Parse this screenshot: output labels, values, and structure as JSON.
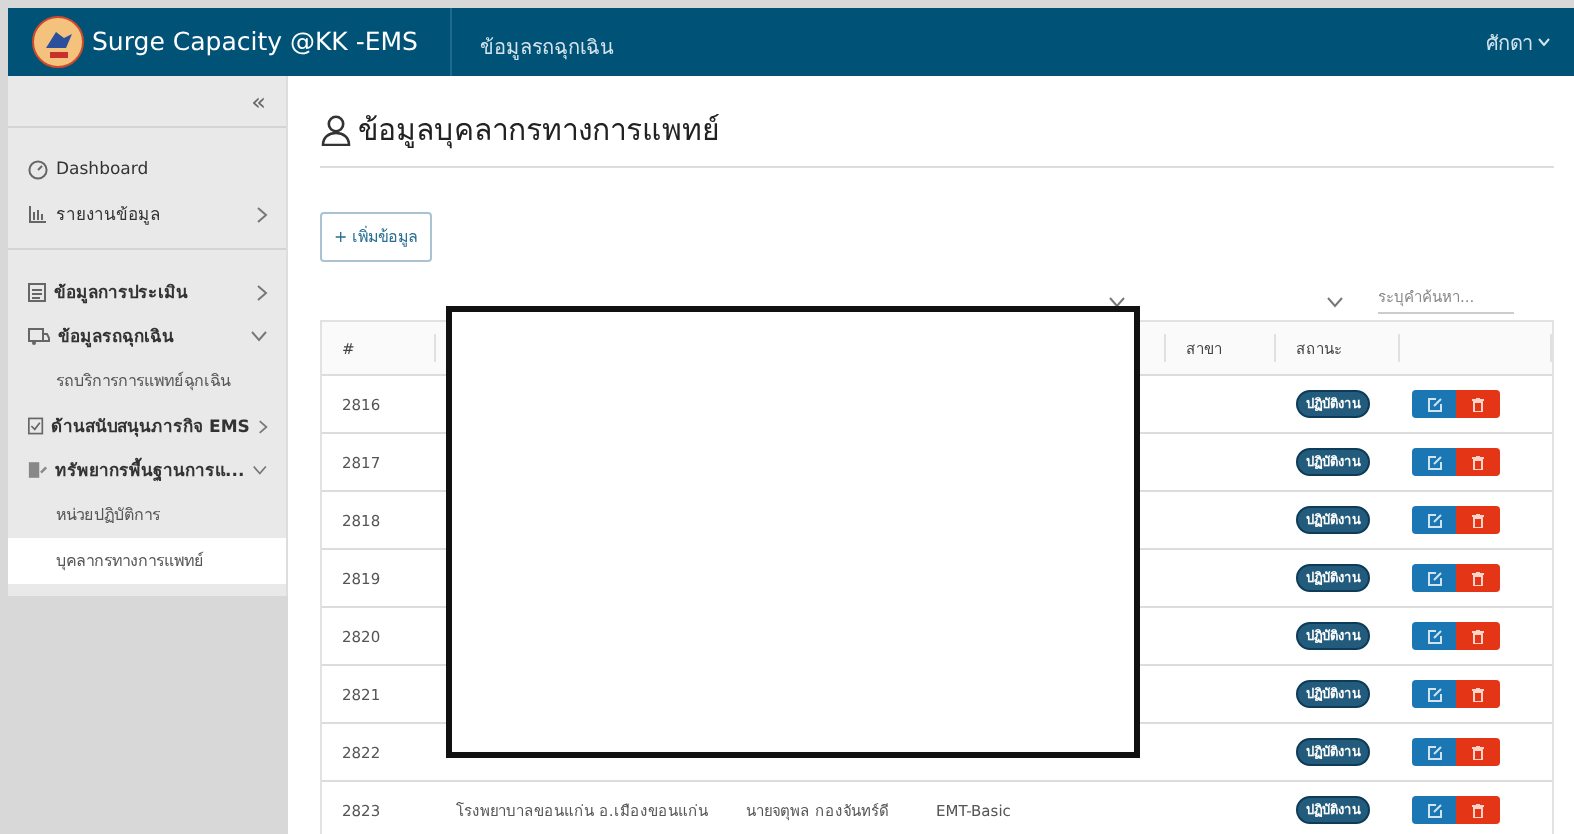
{
  "header": {
    "app_name": "Surge Capacity @KK -EMS",
    "nav": [
      {
        "label": "ข้อมูลรถฉุกเฉิน"
      }
    ],
    "user": "ศักดา"
  },
  "sidebar": {
    "collapse": "«",
    "sections": [
      {
        "items": [
          {
            "label": "Dashboard"
          },
          {
            "label": "รายงานข้อมูล",
            "expanded": false
          }
        ]
      },
      {
        "items": [
          {
            "label": "ข้อมูลการประเมิน",
            "expanded": false
          },
          {
            "label": "ข้อมูลรถฉุกเฉิน",
            "expanded": true,
            "children": [
              {
                "label": "รถบริการการแพทย์ฉุกเฉิน",
                "selected": false
              }
            ]
          },
          {
            "label": "ด้านสนับสนุนภารกิจ EMS",
            "expanded": false
          },
          {
            "label": "ทรัพยากรพื้นฐานการแ...",
            "expanded": true,
            "children": [
              {
                "label": "หน่วยปฏิบัติการ",
                "selected": false
              },
              {
                "label": "บุคลากรทางการแพทย์",
                "selected": true
              }
            ]
          }
        ]
      }
    ]
  },
  "page": {
    "title": "ข้อมูลบุคลากรทางการแพทย์",
    "add_button": "+ เพิ่มข้อมูล",
    "search": {
      "placeholder": "ระบุคำค้นหา..."
    }
  },
  "table": {
    "header": {
      "number": "#",
      "branch": "สาขา",
      "status": "สถานะ"
    },
    "rows": [
      {
        "number": "2816",
        "status": "ปฏิบัติงาน"
      },
      {
        "number": "2817",
        "status": "ปฏิบัติงาน"
      },
      {
        "number": "2818",
        "status": "ปฏิบัติงาน"
      },
      {
        "number": "2819",
        "status": "ปฏิบัติงาน"
      },
      {
        "number": "2820",
        "status": "ปฏิบัติงาน"
      },
      {
        "number": "2821",
        "status": "ปฏิบัติงาน"
      },
      {
        "number": "2822",
        "status": "ปฏิบัติงาน"
      },
      {
        "number": "2823",
        "column_2": "โรงพยาบาลขอนแก่น อ.เมืองขอนแก่น",
        "column_3": "นายจตุพล กองจันทร์ดี",
        "column_4": "EMT-Basic",
        "status": "ปฏิบัติงาน"
      }
    ]
  },
  "redaction_box": true
}
